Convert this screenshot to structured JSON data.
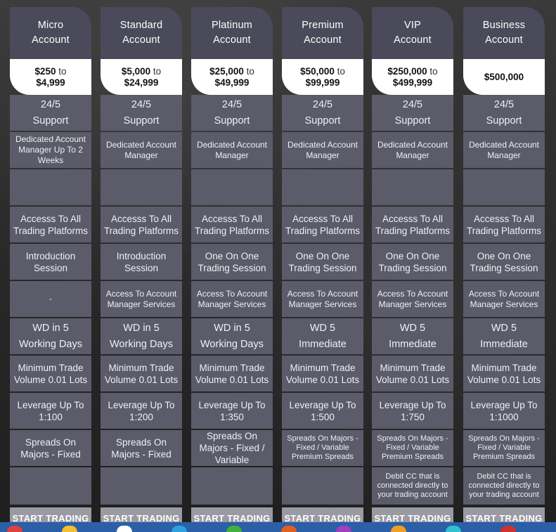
{
  "accounts": [
    {
      "name_line1": "Micro",
      "name_line2": "Account",
      "price_from": "$250",
      "price_to_word": "to",
      "price_to": "$4,999",
      "support_1": "24/5",
      "support_2": "Support",
      "manager": "Dedicated Account Manager Up To 2 Weeks",
      "empty": "",
      "platforms": "Accesss To All Trading Platforms",
      "session": "Introduction Session",
      "services": "-",
      "wd_1": "WD in 5",
      "wd_2": "Working Days",
      "min_trade": "Minimum Trade Volume 0.01 Lots",
      "leverage": "Leverage Up To 1:100",
      "spreads": "Spreads On Majors - Fixed",
      "debit": "",
      "button": "START TRADING"
    },
    {
      "name_line1": "Standard",
      "name_line2": "Account",
      "price_from": "$5,000",
      "price_to_word": "to",
      "price_to": "$24,999",
      "support_1": "24/5",
      "support_2": "Support",
      "manager": "Dedicated Account Manager",
      "empty": "",
      "platforms": "Accesss To All Trading Platforms",
      "session": "Introduction Session",
      "services": "Access To Account Manager Services",
      "wd_1": "WD in 5",
      "wd_2": "Working Days",
      "min_trade": "Minimum Trade Volume 0.01 Lots",
      "leverage": "Leverage Up To 1:200",
      "spreads": "Spreads On Majors - Fixed",
      "debit": "",
      "button": "START TRADING"
    },
    {
      "name_line1": "Platinum",
      "name_line2": "Account",
      "price_from": "$25,000",
      "price_to_word": "to",
      "price_to": "$49,999",
      "support_1": "24/5",
      "support_2": "Support",
      "manager": "Dedicated Account Manager",
      "empty": "",
      "platforms": "Accesss To All Trading Platforms",
      "session": "One On One Trading Session",
      "services": "Access To Account Manager Services",
      "wd_1": "WD in 5",
      "wd_2": "Working Days",
      "min_trade": "Minimum Trade Volume 0.01 Lots",
      "leverage": "Leverage Up To 1:350",
      "spreads": "Spreads On Majors - Fixed / Variable",
      "debit": "",
      "button": "START TRADING"
    },
    {
      "name_line1": "Premium",
      "name_line2": "Account",
      "price_from": "$50,000",
      "price_to_word": "to",
      "price_to": "$99,999",
      "support_1": "24/5",
      "support_2": "Support",
      "manager": "Dedicated Account Manager",
      "empty": "",
      "platforms": "Accesss To All Trading Platforms",
      "session": "One On One Trading Session",
      "services": "Access To Account Manager Services",
      "wd_1": "WD 5",
      "wd_2": "Immediate",
      "min_trade": "Minimum Trade Volume 0.01 Lots",
      "leverage": "Leverage Up To 1:500",
      "spreads": "Spreads On Majors - Fixed / Variable Premium Spreads",
      "debit": "",
      "button": "START TRADING"
    },
    {
      "name_line1": "VIP",
      "name_line2": "Account",
      "price_from": "$250,000",
      "price_to_word": "to",
      "price_to": "$499,999",
      "support_1": "24/5",
      "support_2": "Support",
      "manager": "Dedicated Account Manager",
      "empty": "",
      "platforms": "Accesss To All Trading Platforms",
      "session": "One On One Trading Session",
      "services": "Access To Account Manager Services",
      "wd_1": "WD 5",
      "wd_2": "Immediate",
      "min_trade": "Minimum Trade Volume 0.01 Lots",
      "leverage": "Leverage Up To 1:750",
      "spreads": "Spreads On Majors - Fixed / Variable Premium Spreads",
      "debit": "Debit CC that is connected directly to your trading account",
      "button": "START TRADING"
    },
    {
      "name_line1": "Business",
      "name_line2": "Account",
      "price_from": "$500,000",
      "price_to_word": "",
      "price_to": "",
      "support_1": "24/5",
      "support_2": "Support",
      "manager": "Dedicated Account Manager",
      "empty": "",
      "platforms": "Accesss To All Trading Platforms",
      "session": "One On One Trading Session",
      "services": "Access To Account Manager Services",
      "wd_1": "WD 5",
      "wd_2": "Immediate",
      "min_trade": "Minimum Trade Volume 0.01 Lots",
      "leverage": "Leverage Up To 1:1000",
      "spreads": "Spreads On Majors - Fixed / Variable Premium Spreads",
      "debit": "Debit CC that is connected directly to your trading account",
      "button": "START TRADING"
    }
  ],
  "colors": {
    "header_bg": "#4a4a5a",
    "cell_bg": "#5b5b69",
    "button_bg": "#9a9aa4",
    "price_bg": "#ffffff",
    "taskbar": "#2b5fa8"
  }
}
